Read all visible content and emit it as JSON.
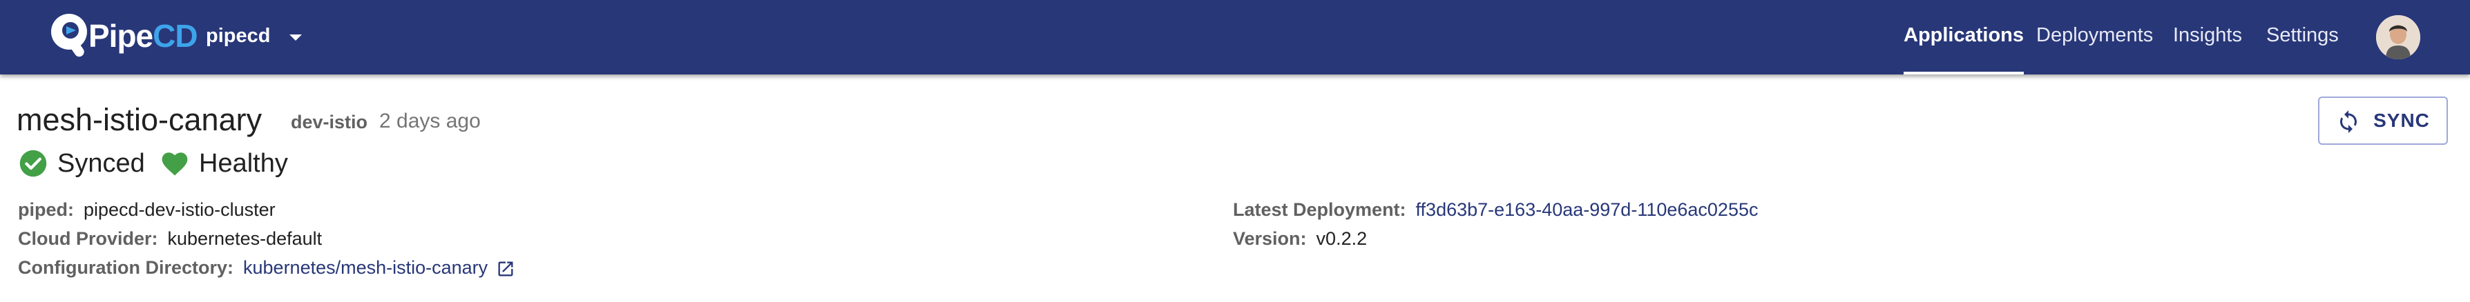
{
  "brand": {
    "name_part1": "Pipe",
    "name_part2": "CD"
  },
  "project": {
    "name": "pipecd"
  },
  "nav": {
    "applications": "Applications",
    "deployments": "Deployments",
    "insights": "Insights",
    "settings": "Settings",
    "active": "applications"
  },
  "app": {
    "name": "mesh-istio-canary",
    "env": "dev-istio",
    "updated": "2 days ago",
    "sync_status": "Synced",
    "health_status": "Healthy",
    "sync_button": "SYNC"
  },
  "details": {
    "piped_label": "piped:",
    "piped_value": "pipecd-dev-istio-cluster",
    "cloud_label": "Cloud Provider:",
    "cloud_value": "kubernetes-default",
    "config_label": "Configuration Directory:",
    "config_value": "kubernetes/mesh-istio-canary",
    "deploy_label": "Latest Deployment:",
    "deploy_value": "ff3d63b7-e163-40aa-997d-110e6ac0255c",
    "version_label": "Version:",
    "version_value": "v0.2.2"
  },
  "colors": {
    "appbar": "#283778",
    "brand_accent": "#3ea4ea",
    "success": "#43a047",
    "link": "#283778"
  },
  "icons": {
    "logo": "pipecd-logo-icon",
    "project_caret": "caret-down-icon",
    "sync_status": "check-circle-icon",
    "health_status": "heart-icon",
    "sync_button": "sync-icon",
    "external_link": "open-in-new-icon",
    "avatar": "user-avatar"
  }
}
